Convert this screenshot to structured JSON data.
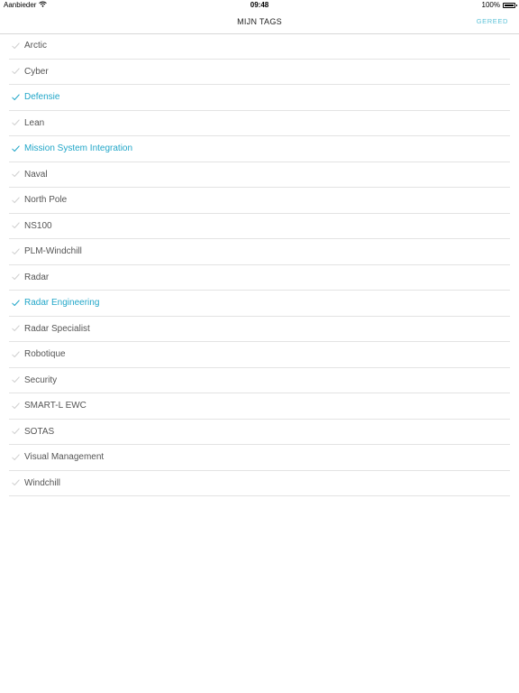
{
  "status_bar": {
    "carrier": "Aanbieder",
    "time": "09:48",
    "battery": "100%",
    "icons": {
      "wifi": "wifi-icon",
      "battery": "battery-icon"
    }
  },
  "nav": {
    "title": "MIJN TAGS",
    "done_label": "GEREED"
  },
  "colors": {
    "accent": "#21a6c8",
    "done": "#5ec3d8",
    "unselected_check": "#d0d0d0",
    "text": "#555555",
    "divider": "#e3e3e3"
  },
  "tags": [
    {
      "label": "Arctic",
      "selected": false
    },
    {
      "label": "Cyber",
      "selected": false
    },
    {
      "label": "Defensie",
      "selected": true
    },
    {
      "label": "Lean",
      "selected": false
    },
    {
      "label": "Mission System Integration",
      "selected": true
    },
    {
      "label": "Naval",
      "selected": false
    },
    {
      "label": "North Pole",
      "selected": false
    },
    {
      "label": "NS100",
      "selected": false
    },
    {
      "label": "PLM-Windchill",
      "selected": false
    },
    {
      "label": "Radar",
      "selected": false
    },
    {
      "label": "Radar Engineering",
      "selected": true
    },
    {
      "label": "Radar Specialist",
      "selected": false
    },
    {
      "label": "Robotique",
      "selected": false
    },
    {
      "label": "Security",
      "selected": false
    },
    {
      "label": "SMART-L EWC",
      "selected": false
    },
    {
      "label": "SOTAS",
      "selected": false
    },
    {
      "label": "Visual Management",
      "selected": false
    },
    {
      "label": "Windchill",
      "selected": false
    }
  ]
}
